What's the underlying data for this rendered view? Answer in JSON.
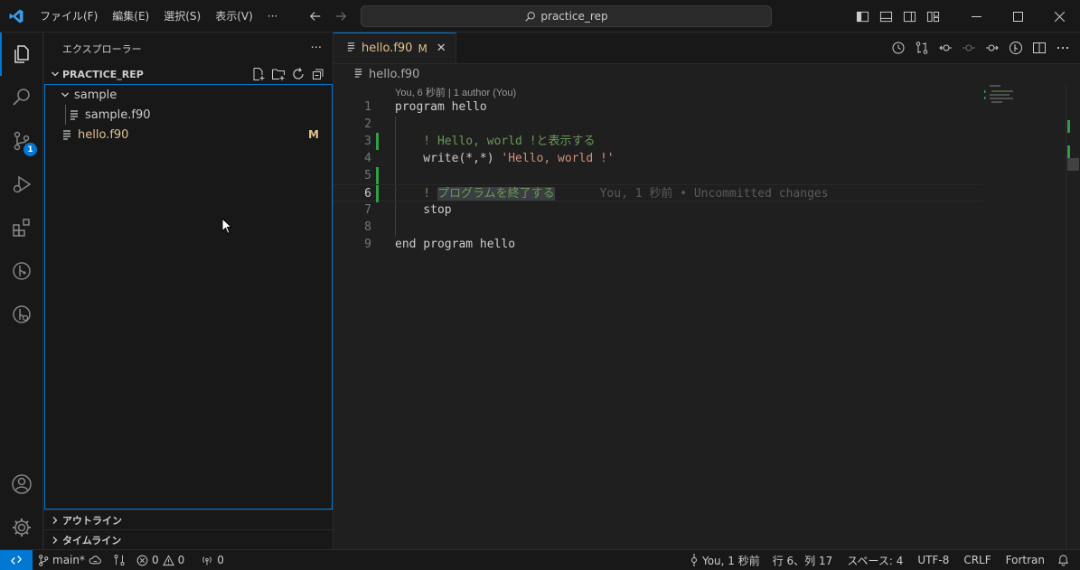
{
  "menu": [
    "ファイル(F)",
    "編集(E)",
    "選択(S)",
    "表示(V)",
    "···"
  ],
  "search": {
    "text": "practice_rep"
  },
  "sidebar": {
    "title": "エクスプローラー",
    "more": "···",
    "section": "PRACTICE_REP",
    "tree": [
      {
        "label": "sample",
        "type": "folder"
      },
      {
        "label": "sample.f90",
        "type": "file"
      },
      {
        "label": "hello.f90",
        "type": "file",
        "badge": "M"
      }
    ],
    "outline": "アウトライン",
    "timeline": "タイムライン"
  },
  "activity": {
    "scm_badge": "1"
  },
  "editor": {
    "tab": {
      "label": "hello.f90",
      "status": "M",
      "close": "✕"
    },
    "breadcrumb": "hello.f90",
    "codelens": "You, 6 秒前 | 1 author (You)",
    "lines": [
      {
        "n": "1",
        "text": "program hello"
      },
      {
        "n": "2",
        "text": ""
      },
      {
        "n": "3",
        "text": "    ! Hello, world !と表示する"
      },
      {
        "n": "4",
        "text": "    write(*,*) 'Hello, world !'"
      },
      {
        "n": "5",
        "text": ""
      },
      {
        "n": "6",
        "text": "    ! プログラムを終了する"
      },
      {
        "n": "7",
        "text": "    stop"
      },
      {
        "n": "8",
        "text": ""
      },
      {
        "n": "9",
        "text": "end program hello"
      }
    ],
    "blame": "You, 1 秒前 • Uncommitted changes"
  },
  "status": {
    "branch": "main*",
    "errors": "0",
    "warnings": "0",
    "ports": "0",
    "blame": "You, 1 秒前",
    "position": "行 6、列 17",
    "spaces": "スペース: 4",
    "encoding": "UTF-8",
    "eol": "CRLF",
    "language": "Fortran"
  },
  "colors": {
    "accent": "#0078d4",
    "modified": "#e2c08d",
    "comment": "#6a9955",
    "string": "#ce9178",
    "added": "#2ea043"
  }
}
